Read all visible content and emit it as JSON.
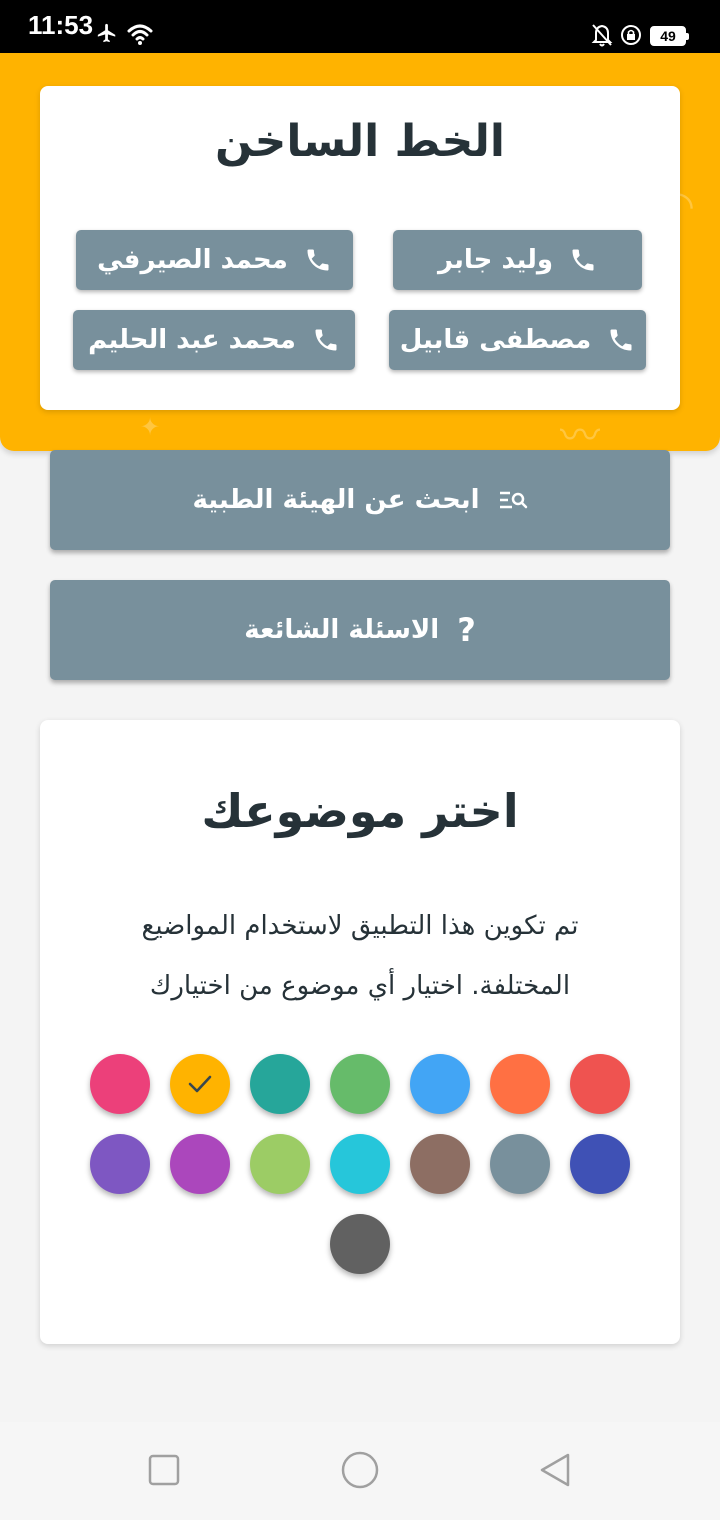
{
  "status_bar": {
    "time": "11:53",
    "battery": "49",
    "icons": [
      "airplane-icon",
      "wifi-icon",
      "bell-off-icon",
      "lock-rotation-icon",
      "battery-icon"
    ]
  },
  "hotline": {
    "title": "الخط الساخن",
    "contacts": [
      {
        "name": "وليد جابر",
        "icon": "phone-icon"
      },
      {
        "name": "محمد الصيرفي",
        "icon": "phone-icon"
      },
      {
        "name": "مصطفى قابيل",
        "icon": "phone-icon"
      },
      {
        "name": "محمد عبد الحليم",
        "icon": "phone-icon"
      }
    ],
    "background_color": "#ffb300"
  },
  "actions": {
    "search_staff": {
      "label": "ابحث عن الهيئة الطبية",
      "icon": "search-list-icon"
    },
    "faq": {
      "label": "الاسئلة الشائعة",
      "icon": "?"
    }
  },
  "theme": {
    "title": "اختر موضوعك",
    "description": "تم تكوين هذا التطبيق لاستخدام المواضيع المختلفة. اختيار أي موضوع من اختيارك",
    "selected_color": "#ffb300",
    "colors": [
      "#ef5350",
      "#ff7043",
      "#42a5f5",
      "#66bb6a",
      "#26a69a",
      "#ffb300",
      "#ec407a",
      "#3f51b5",
      "#78909c",
      "#8d6e63",
      "#26c6da",
      "#9ccc65",
      "#ab47bc",
      "#7e57c2",
      "#616161"
    ]
  },
  "accent_color": "#78909c",
  "navigation_bar": {
    "buttons": [
      "recent-apps-icon",
      "home-icon",
      "back-icon"
    ]
  }
}
